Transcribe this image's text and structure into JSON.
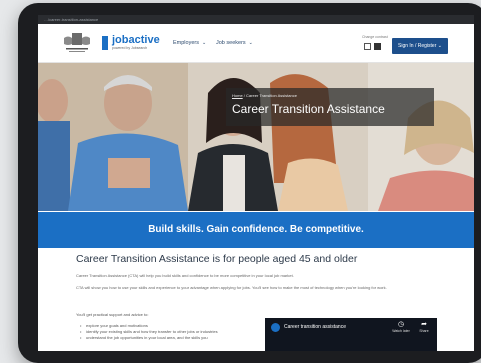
{
  "browser": {
    "url": "…/career-transition-assistance"
  },
  "header": {
    "logo_name": "jobactive",
    "logo_sub": "powered by Jobsearch",
    "nav": [
      {
        "label": "Employers",
        "icon": "chevron-down-icon"
      },
      {
        "label": "Job seekers",
        "icon": "chevron-down-icon"
      }
    ],
    "contrast_label": "Change contrast",
    "signin_label": "Sign In / Register",
    "signin_icon": "chevron-down-icon"
  },
  "hero": {
    "breadcrumb_home": "Home",
    "breadcrumb_sep": "/",
    "breadcrumb_current": "Career Transition Assistance",
    "title": "Career Transition Assistance"
  },
  "banner": {
    "text": "Build skills. Gain confidence. Be competitive."
  },
  "content": {
    "heading": "Career Transition Assistance is for people aged 45 and older",
    "para1": "Career Transition Assistance (CTA) will help you build skills and confidence to be more competitive in your local job market.",
    "para2": "CTA will show you how to use your skills and experience to your advantage when applying for jobs. You'll see how to make the most of technology when you're looking for work.",
    "support_text": "You'll get practical support and advice to:",
    "bullets": [
      "explore your goals and motivations",
      "identify your existing skills and how they transfer to other jobs or industries",
      "understand the job opportunities in your local area, and the skills you"
    ]
  },
  "video": {
    "title": "Career transition assistance",
    "watch_later": "Watch later",
    "share": "Share"
  },
  "colors": {
    "brand_blue": "#1b6fc4",
    "nav_blue": "#1d4f8c",
    "heading": "#2d3a4a"
  }
}
